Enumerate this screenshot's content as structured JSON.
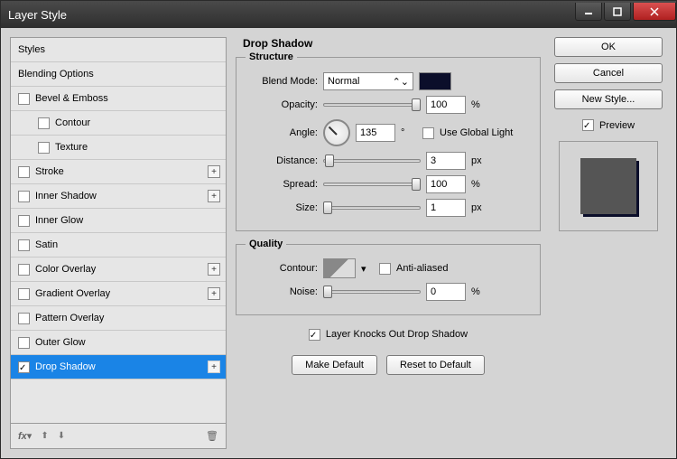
{
  "window": {
    "title": "Layer Style"
  },
  "sidebar": {
    "items": [
      {
        "label": "Styles",
        "checkbox": false,
        "indent": false,
        "plus": false,
        "active": false
      },
      {
        "label": "Blending Options",
        "checkbox": false,
        "indent": false,
        "plus": false,
        "active": false
      },
      {
        "label": "Bevel & Emboss",
        "checkbox": true,
        "checked": false,
        "indent": false,
        "plus": false,
        "active": false
      },
      {
        "label": "Contour",
        "checkbox": true,
        "checked": false,
        "indent": true,
        "plus": false,
        "active": false
      },
      {
        "label": "Texture",
        "checkbox": true,
        "checked": false,
        "indent": true,
        "plus": false,
        "active": false
      },
      {
        "label": "Stroke",
        "checkbox": true,
        "checked": false,
        "indent": false,
        "plus": true,
        "active": false
      },
      {
        "label": "Inner Shadow",
        "checkbox": true,
        "checked": false,
        "indent": false,
        "plus": true,
        "active": false
      },
      {
        "label": "Inner Glow",
        "checkbox": true,
        "checked": false,
        "indent": false,
        "plus": false,
        "active": false
      },
      {
        "label": "Satin",
        "checkbox": true,
        "checked": false,
        "indent": false,
        "plus": false,
        "active": false
      },
      {
        "label": "Color Overlay",
        "checkbox": true,
        "checked": false,
        "indent": false,
        "plus": true,
        "active": false
      },
      {
        "label": "Gradient Overlay",
        "checkbox": true,
        "checked": false,
        "indent": false,
        "plus": true,
        "active": false
      },
      {
        "label": "Pattern Overlay",
        "checkbox": true,
        "checked": false,
        "indent": false,
        "plus": false,
        "active": false
      },
      {
        "label": "Outer Glow",
        "checkbox": true,
        "checked": false,
        "indent": false,
        "plus": false,
        "active": false
      },
      {
        "label": "Drop Shadow",
        "checkbox": true,
        "checked": true,
        "indent": false,
        "plus": true,
        "active": true
      }
    ]
  },
  "main": {
    "title": "Drop Shadow",
    "structure": {
      "legend": "Structure",
      "blend_mode_label": "Blend Mode:",
      "blend_mode_value": "Normal",
      "color": "#0b0e2a",
      "opacity_label": "Opacity:",
      "opacity_value": "100",
      "opacity_unit": "%",
      "angle_label": "Angle:",
      "angle_value": "135",
      "angle_unit": "°",
      "use_global_label": "Use Global Light",
      "use_global_checked": false,
      "distance_label": "Distance:",
      "distance_value": "3",
      "distance_unit": "px",
      "spread_label": "Spread:",
      "spread_value": "100",
      "spread_unit": "%",
      "size_label": "Size:",
      "size_value": "1",
      "size_unit": "px"
    },
    "quality": {
      "legend": "Quality",
      "contour_label": "Contour:",
      "antialiased_label": "Anti-aliased",
      "antialiased_checked": false,
      "noise_label": "Noise:",
      "noise_value": "0",
      "noise_unit": "%"
    },
    "knockout_label": "Layer Knocks Out Drop Shadow",
    "knockout_checked": true,
    "make_default": "Make Default",
    "reset_default": "Reset to Default"
  },
  "right": {
    "ok": "OK",
    "cancel": "Cancel",
    "new_style": "New Style...",
    "preview_label": "Preview",
    "preview_checked": true
  }
}
